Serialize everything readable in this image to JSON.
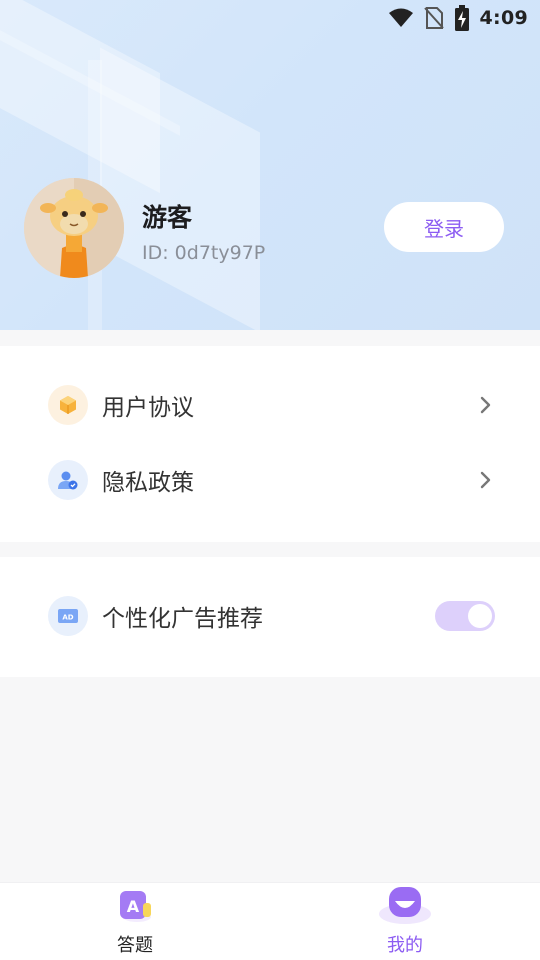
{
  "status_bar": {
    "time": "4:09",
    "icons": [
      "wifi-icon",
      "no-sim-icon",
      "battery-charging-icon"
    ]
  },
  "profile": {
    "name": "游客",
    "id_text": "ID: 0d7ty97P",
    "avatar": "camel-avatar",
    "login_label": "登录"
  },
  "menu": {
    "items": [
      {
        "label": "用户协议",
        "icon": "cube-icon",
        "icon_bg": "#fdf1e0"
      },
      {
        "label": "隐私政策",
        "icon": "user-shield-icon",
        "icon_bg": "#e8f0fc"
      }
    ]
  },
  "settings": {
    "ad_label": "个性化广告推荐",
    "ad_icon": "ad-icon",
    "ad_enabled": true
  },
  "bottom_nav": {
    "items": [
      {
        "label": "答题",
        "icon": "quiz-a-icon",
        "active": false
      },
      {
        "label": "我的",
        "icon": "smile-icon",
        "active": true
      }
    ]
  },
  "colors": {
    "accent": "#8c5cf2",
    "toggle_track": "#ddd0fb",
    "header_bg": "#d4e6fa"
  }
}
